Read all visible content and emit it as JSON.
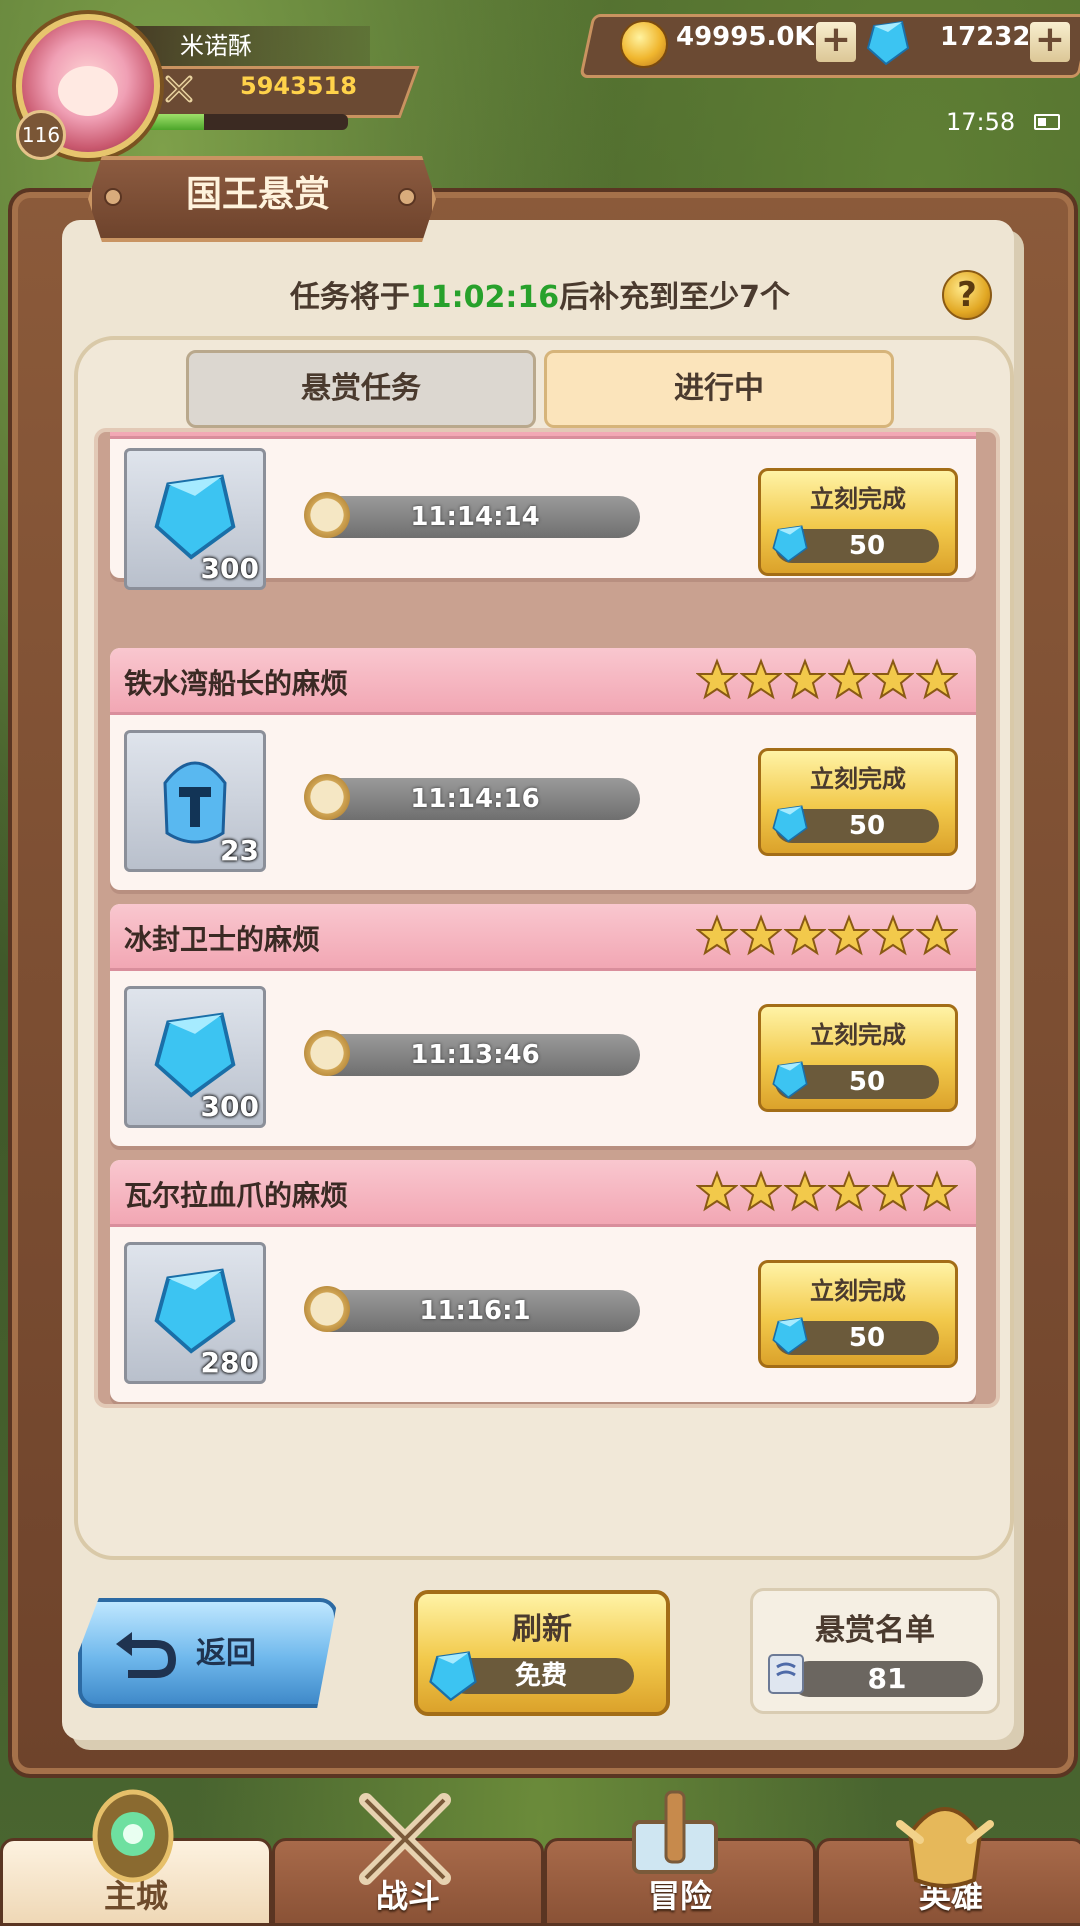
{
  "player": {
    "name": "米诺酥",
    "level": "116",
    "power": "5943518",
    "exp_fraction": 0.3
  },
  "resources": {
    "coins": "49995.0K",
    "gems": "17232",
    "plus": "+"
  },
  "status": {
    "time": "17:58"
  },
  "window": {
    "title": "国王悬赏"
  },
  "refill": {
    "prefix": "任务将于",
    "countdown": "11:02:16",
    "suffix": "后补充到至少7个",
    "help": "?"
  },
  "tabs": {
    "bounty": "悬赏任务",
    "in_progress": "进行中"
  },
  "tasks": [
    {
      "title": "",
      "reward_count": "300",
      "time": "11:14:14",
      "finish_label": "立刻完成",
      "cost": "50"
    },
    {
      "title": "铁水湾船长的麻烦",
      "reward_count": "23",
      "time": "11:14:16",
      "finish_label": "立刻完成",
      "cost": "50"
    },
    {
      "title": "冰封卫士的麻烦",
      "reward_count": "300",
      "time": "11:13:46",
      "finish_label": "立刻完成",
      "cost": "50"
    },
    {
      "title": "瓦尔拉血爪的麻烦",
      "reward_count": "280",
      "time": "11:16:1",
      "finish_label": "立刻完成",
      "cost": "50"
    }
  ],
  "buttons": {
    "back": "返回",
    "refresh": "刷新",
    "refresh_cost": "免费",
    "bounty_list": "悬赏名单",
    "bounty_list_count": "81"
  },
  "nav": [
    "主城",
    "战斗",
    "冒险",
    "英雄"
  ],
  "colors": {
    "accent_green": "#27a12b",
    "frame_brown": "#6e432b",
    "gold": "#f2c94b"
  }
}
